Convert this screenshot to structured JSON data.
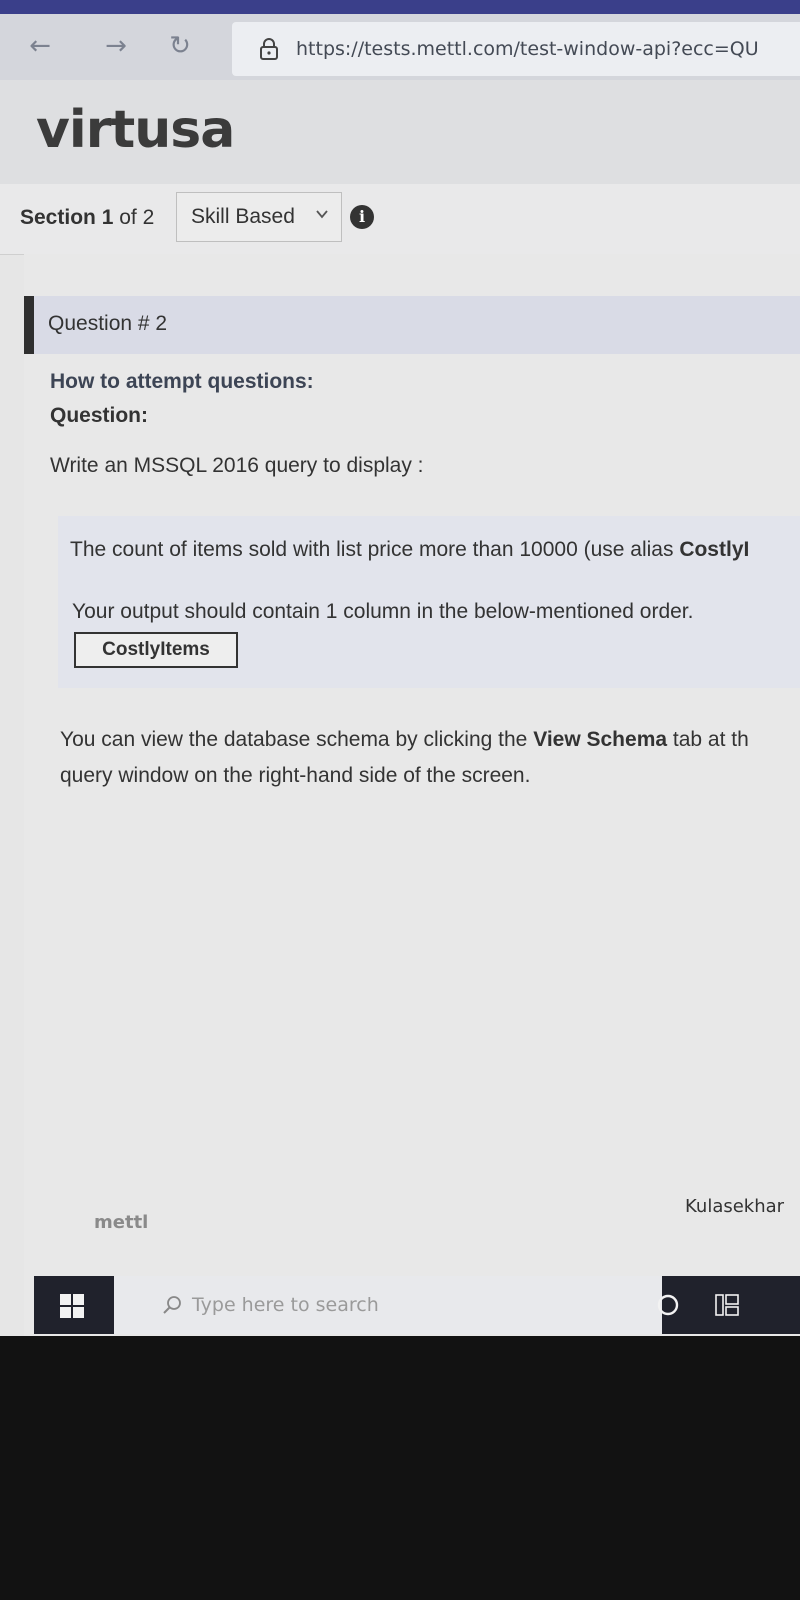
{
  "browser": {
    "back_icon": "back-arrow-icon",
    "forward_icon": "forward-arrow-icon",
    "reload_icon": "reload-icon",
    "lock_icon": "lock-icon",
    "url": "https://tests.mettl.com/test-window-api?ecc=QU"
  },
  "header": {
    "logo": "virtusa"
  },
  "section": {
    "label_prefix": "Section ",
    "current": "1",
    "separator": " of ",
    "total": "2",
    "selected": "Skill Based"
  },
  "question": {
    "title": "Question # 2",
    "how_to": "How to attempt questions:",
    "label": "Question:",
    "prompt": "Write an MSSQL 2016 query to display :",
    "task_text": "The count of items sold with list price more than 10000 (use alias ",
    "task_alias": "CostlyI",
    "output_note": "Your output should contain 1 column in the below-mentioned order.",
    "column_name": "CostlyItems",
    "schema_text_1": "You can view the database schema by clicking the ",
    "schema_tab": "View Schema",
    "schema_text_2": " tab at th",
    "schema_text_3": "query window on the right-hand side of the screen."
  },
  "footer": {
    "brand": "mettl",
    "user": "Kulasekhar"
  },
  "taskbar": {
    "search_placeholder": "Type here to search"
  },
  "colors": {
    "accent_bar": "#2f2f2f",
    "question_bg": "#d9dbe6",
    "taskbar": "#20222c"
  }
}
